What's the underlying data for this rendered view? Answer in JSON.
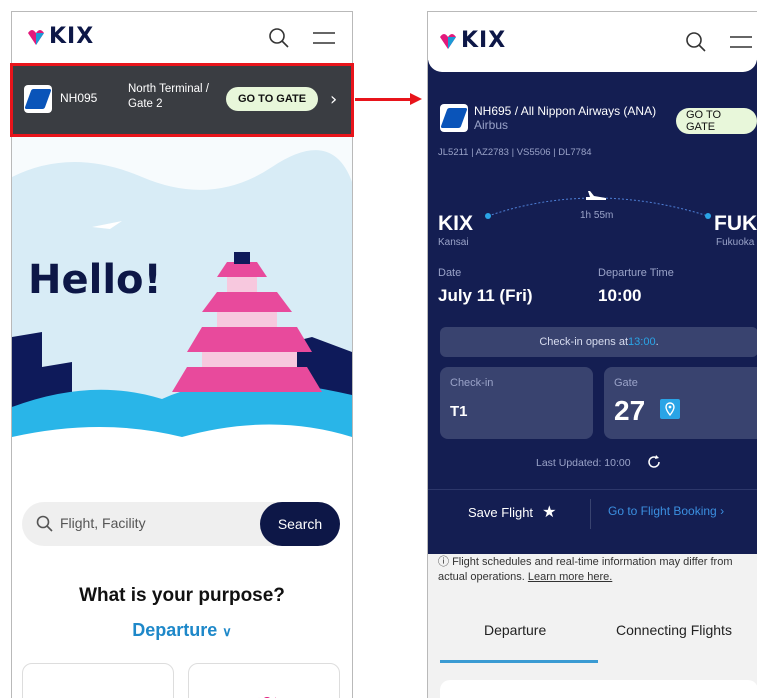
{
  "colors": {
    "navy": "#0d1747",
    "panel": "#141e52",
    "accent_blue": "#1e88c9",
    "go_gate_bg": "#e8f7da",
    "highlight_red": "#e8141b",
    "gate_pin": "#2aa4e6"
  },
  "left": {
    "logo": "KIX",
    "banner": {
      "flight": "NH095",
      "terminal_line1": "North Terminal /",
      "terminal_line2": "Gate 2",
      "go_gate": "GO TO GATE"
    },
    "hero_title": "Hello!",
    "search": {
      "placeholder": "Flight, Facility",
      "button": "Search"
    },
    "purpose_title": "What is your purpose?",
    "purpose_selected": "Departure"
  },
  "right": {
    "logo": "KIX",
    "flight_title": "NH695 / All Nippon Airways (ANA)",
    "aircraft": "Airbus",
    "go_gate": "GO TO GATE",
    "codeshares": "JL5211 | AZ2783 | VS5506 | DL7784",
    "duration": "1h 55m",
    "origin": {
      "code": "KIX",
      "name": "Kansai"
    },
    "destination": {
      "code": "FUK",
      "name": "Fukuoka"
    },
    "date_label": "Date",
    "date_value": "July 11 (Fri)",
    "dep_time_label": "Departure Time",
    "dep_time_value": "10:00",
    "checkin_notice_prefix": "Check-in opens at ",
    "checkin_notice_time": "13:00",
    "checkin_notice_suffix": ".",
    "checkin_label": "Check-in",
    "checkin_value": "T1",
    "gate_label": "Gate",
    "gate_value": "27",
    "last_updated": "Last Updated: 10:00",
    "save_flight": "Save Flight",
    "go_to_booking": "Go to Flight Booking",
    "notice_text": "Flight schedules and real-time information may differ from actual operations.",
    "notice_link": "Learn more here.",
    "tab_departure": "Departure",
    "tab_connecting": "Connecting Flights"
  }
}
